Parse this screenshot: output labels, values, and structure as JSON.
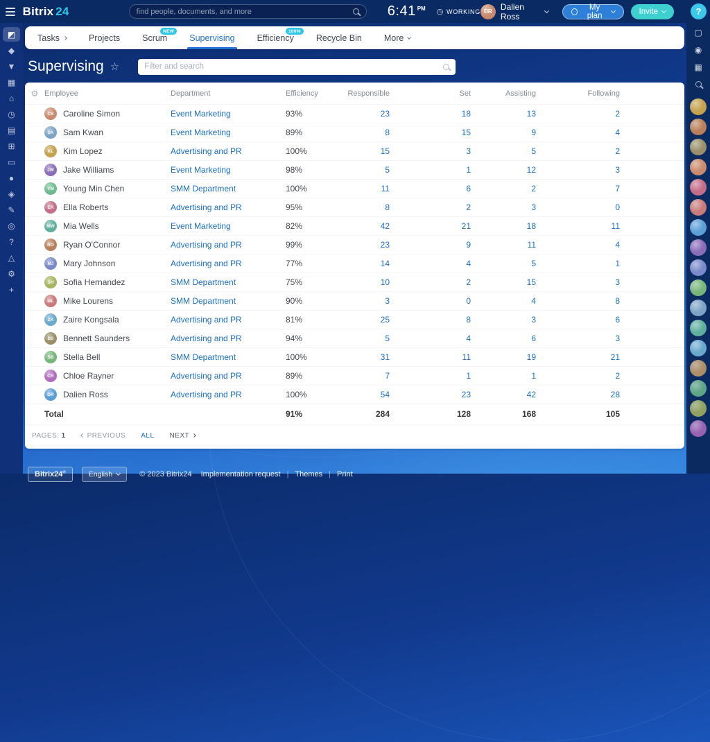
{
  "colors": {
    "topbar_navy": "#0a2a64",
    "rail_navy": "#11307a",
    "link_blue": "#1b6fc2",
    "active_tab_blue": "#2373d4",
    "accent_cyan": "#2fc7e8",
    "invite_teal": "#3ed0cf",
    "plan_blue": "#2e7fd8"
  },
  "topbar": {
    "logo_primary": "Bitrix",
    "logo_secondary": "24",
    "search_placeholder": "find people, documents, and more",
    "time": "6:41",
    "meridiem": "PM",
    "status": "WORKING",
    "user_name": "Dalien Ross",
    "my_plan": "My plan",
    "invite": "Invite",
    "help": "?"
  },
  "left_rail": {
    "icons": [
      {
        "name": "messenger-icon",
        "glyph": "◩",
        "active": true
      },
      {
        "name": "feed-icon",
        "glyph": "◆"
      },
      {
        "name": "crm-icon",
        "glyph": "▼"
      },
      {
        "name": "calendar-icon",
        "glyph": "▦"
      },
      {
        "name": "drive-icon",
        "glyph": "⌂"
      },
      {
        "name": "time-icon",
        "glyph": "◷"
      },
      {
        "name": "workgroups-icon",
        "glyph": "▤"
      },
      {
        "name": "marketplace-icon",
        "glyph": "⊞"
      },
      {
        "name": "shop-icon",
        "glyph": "▭"
      },
      {
        "name": "video-icon",
        "glyph": "●"
      },
      {
        "name": "company-icon",
        "glyph": "◈"
      },
      {
        "name": "sign-icon",
        "glyph": "✎"
      },
      {
        "name": "automation-icon",
        "glyph": "◎"
      },
      {
        "name": "support-icon",
        "glyph": "?"
      },
      {
        "name": "lab-icon",
        "glyph": "△"
      },
      {
        "name": "settings-icon",
        "glyph": "⚙"
      },
      {
        "name": "add-icon",
        "glyph": "+"
      }
    ]
  },
  "nav": {
    "tabs": [
      {
        "label": "Tasks",
        "chevron": "right"
      },
      {
        "label": "Projects"
      },
      {
        "label": "Scrum",
        "badge": "NEW"
      },
      {
        "label": "Supervising",
        "active": true
      },
      {
        "label": "Efficiency",
        "badge": "100%"
      },
      {
        "label": "Recycle Bin"
      },
      {
        "label": "More",
        "chevron": "down"
      }
    ]
  },
  "page": {
    "title": "Supervising",
    "filter_placeholder": "Filter and search"
  },
  "table": {
    "columns": [
      "Employee",
      "Department",
      "Efficiency",
      "Responsible",
      "Set",
      "Assisting",
      "Following"
    ],
    "rows": [
      {
        "employee": "Caroline Simon",
        "department": "Event Marketing",
        "efficiency": "93%",
        "responsible": "23",
        "set": "18",
        "assisting": "13",
        "following": "2"
      },
      {
        "employee": "Sam Kwan",
        "department": "Event Marketing",
        "efficiency": "89%",
        "responsible": "8",
        "set": "15",
        "assisting": "9",
        "following": "4"
      },
      {
        "employee": "Kim Lopez",
        "department": "Advertising and PR",
        "efficiency": "100%",
        "responsible": "15",
        "set": "3",
        "assisting": "5",
        "following": "2"
      },
      {
        "employee": "Jake Williams",
        "department": "Event Marketing",
        "efficiency": "98%",
        "responsible": "5",
        "set": "1",
        "assisting": "12",
        "following": "3"
      },
      {
        "employee": "Young Min Chen",
        "department": "SMM Department",
        "efficiency": "100%",
        "responsible": "11",
        "set": "6",
        "assisting": "2",
        "following": "7"
      },
      {
        "employee": "Ella Roberts",
        "department": "Advertising and PR",
        "efficiency": "95%",
        "responsible": "8",
        "set": "2",
        "assisting": "3",
        "following": "0"
      },
      {
        "employee": "Mia Wells",
        "department": "Event Marketing",
        "efficiency": "82%",
        "responsible": "42",
        "set": "21",
        "assisting": "18",
        "following": "11"
      },
      {
        "employee": "Ryan O'Connor",
        "department": "Advertising and PR",
        "efficiency": "99%",
        "responsible": "23",
        "set": "9",
        "assisting": "11",
        "following": "4"
      },
      {
        "employee": "Mary Johnson",
        "department": "Advertising and PR",
        "efficiency": "77%",
        "responsible": "14",
        "set": "4",
        "assisting": "5",
        "following": "1"
      },
      {
        "employee": "Sofia Hernandez",
        "department": "SMM Department",
        "efficiency": "75%",
        "responsible": "10",
        "set": "2",
        "assisting": "15",
        "following": "3"
      },
      {
        "employee": "Mike Lourens",
        "department": "SMM Department",
        "efficiency": "90%",
        "responsible": "3",
        "set": "0",
        "assisting": "4",
        "following": "8"
      },
      {
        "employee": "Zaire Kongsala",
        "department": "Advertising and PR",
        "efficiency": "81%",
        "responsible": "25",
        "set": "8",
        "assisting": "3",
        "following": "6"
      },
      {
        "employee": "Bennett Saunders",
        "department": "Advertising and PR",
        "efficiency": "94%",
        "responsible": "5",
        "set": "4",
        "assisting": "6",
        "following": "3"
      },
      {
        "employee": "Stella Bell",
        "department": "SMM Department",
        "efficiency": "100%",
        "responsible": "31",
        "set": "11",
        "assisting": "19",
        "following": "21"
      },
      {
        "employee": "Chloe Rayner",
        "department": "Advertising and PR",
        "efficiency": "89%",
        "responsible": "7",
        "set": "1",
        "assisting": "1",
        "following": "2"
      },
      {
        "employee": "Dalien Ross",
        "department": "Advertising and PR",
        "efficiency": "100%",
        "responsible": "54",
        "set": "23",
        "assisting": "42",
        "following": "28"
      }
    ],
    "total": {
      "label": "Total",
      "efficiency": "91%",
      "responsible": "284",
      "set": "128",
      "assisting": "168",
      "following": "105"
    }
  },
  "pagination": {
    "pages_label": "PAGES:",
    "page": "1",
    "previous": "PREVIOUS",
    "all": "ALL",
    "next": "NEXT"
  },
  "right_rail": {
    "icons": [
      {
        "name": "desktop-app-icon",
        "glyph": "▢"
      },
      {
        "name": "notifications-icon",
        "glyph": "◉"
      },
      {
        "name": "qr-login-icon",
        "glyph": "▦"
      },
      {
        "name": "search-icon",
        "glyph": "mag"
      }
    ],
    "avatar_count": 17
  },
  "footer": {
    "logo": "Bitrix24",
    "logo_sup": "®",
    "language": "English",
    "copyright": "© 2023 Bitrix24",
    "links": [
      "Implementation request",
      "Themes",
      "Print"
    ]
  }
}
